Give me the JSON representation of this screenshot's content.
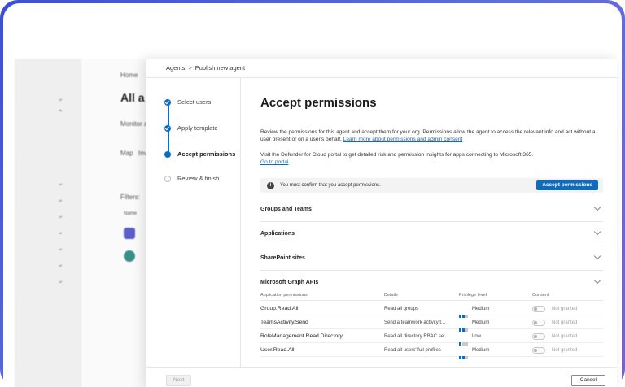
{
  "background_app": {
    "breadcrumb": "Home",
    "page_title": "All a",
    "subtitle": "Monitor a",
    "tab_map": "Map",
    "tab_inv": "Inv",
    "filters_label": "Filters:",
    "name_header": "Name"
  },
  "modal": {
    "breadcrumb": {
      "root": "Agents",
      "separator": ">",
      "current": "Publish new agent"
    },
    "steps": [
      {
        "label": "Select users",
        "state": "done"
      },
      {
        "label": "Apply template",
        "state": "done"
      },
      {
        "label": "Accept permissions",
        "state": "active"
      },
      {
        "label": "Review & finish",
        "state": "pending"
      }
    ],
    "title": "Accept permissions",
    "description": "Review the permissions for this agent and accept them for your org. Permissions allow the agent to access the relevant info and act without a user present or on a user's behalf.",
    "description_link": "Learn more about permissions and admin consent",
    "defender_text": "Visit the Defender for Cloud portal to get detailed risk and permission insights for apps connecting to Microsoft 365.",
    "defender_link": "Go to portal",
    "banner": {
      "message": "You must confirm that you accept permissions.",
      "button": "Accept permissions"
    },
    "sections": [
      {
        "title": "Groups and Teams"
      },
      {
        "title": "Applications"
      },
      {
        "title": "SharePoint sites"
      },
      {
        "title": "Microsoft Graph APIs"
      }
    ],
    "table": {
      "headers": [
        "Application permissions",
        "Details",
        "Privilege level",
        "Consent"
      ],
      "rows": [
        {
          "name": "Group.Read.All",
          "details": "Read all groups",
          "privilege": "Medium",
          "level": 2,
          "consent": "Not granted"
        },
        {
          "name": "TeamsActivity.Send",
          "details": "Send a teamwork activity t...",
          "privilege": "Medium",
          "level": 2,
          "consent": "Not granted"
        },
        {
          "name": "RoleManagement.Read.Directory",
          "details": "Read all directory RBAC set...",
          "privilege": "Low",
          "level": 1,
          "consent": "Not granted"
        },
        {
          "name": "User.Read.All",
          "details": "Read all users' full profiles",
          "privilege": "Medium",
          "level": 2,
          "consent": "Not granted"
        }
      ]
    },
    "footer": {
      "next": "Next",
      "cancel": "Cancel"
    }
  },
  "colors": {
    "accent": "#0f6cbd",
    "frame_start": "#3b4fd6",
    "frame_end": "#7b61c9"
  }
}
